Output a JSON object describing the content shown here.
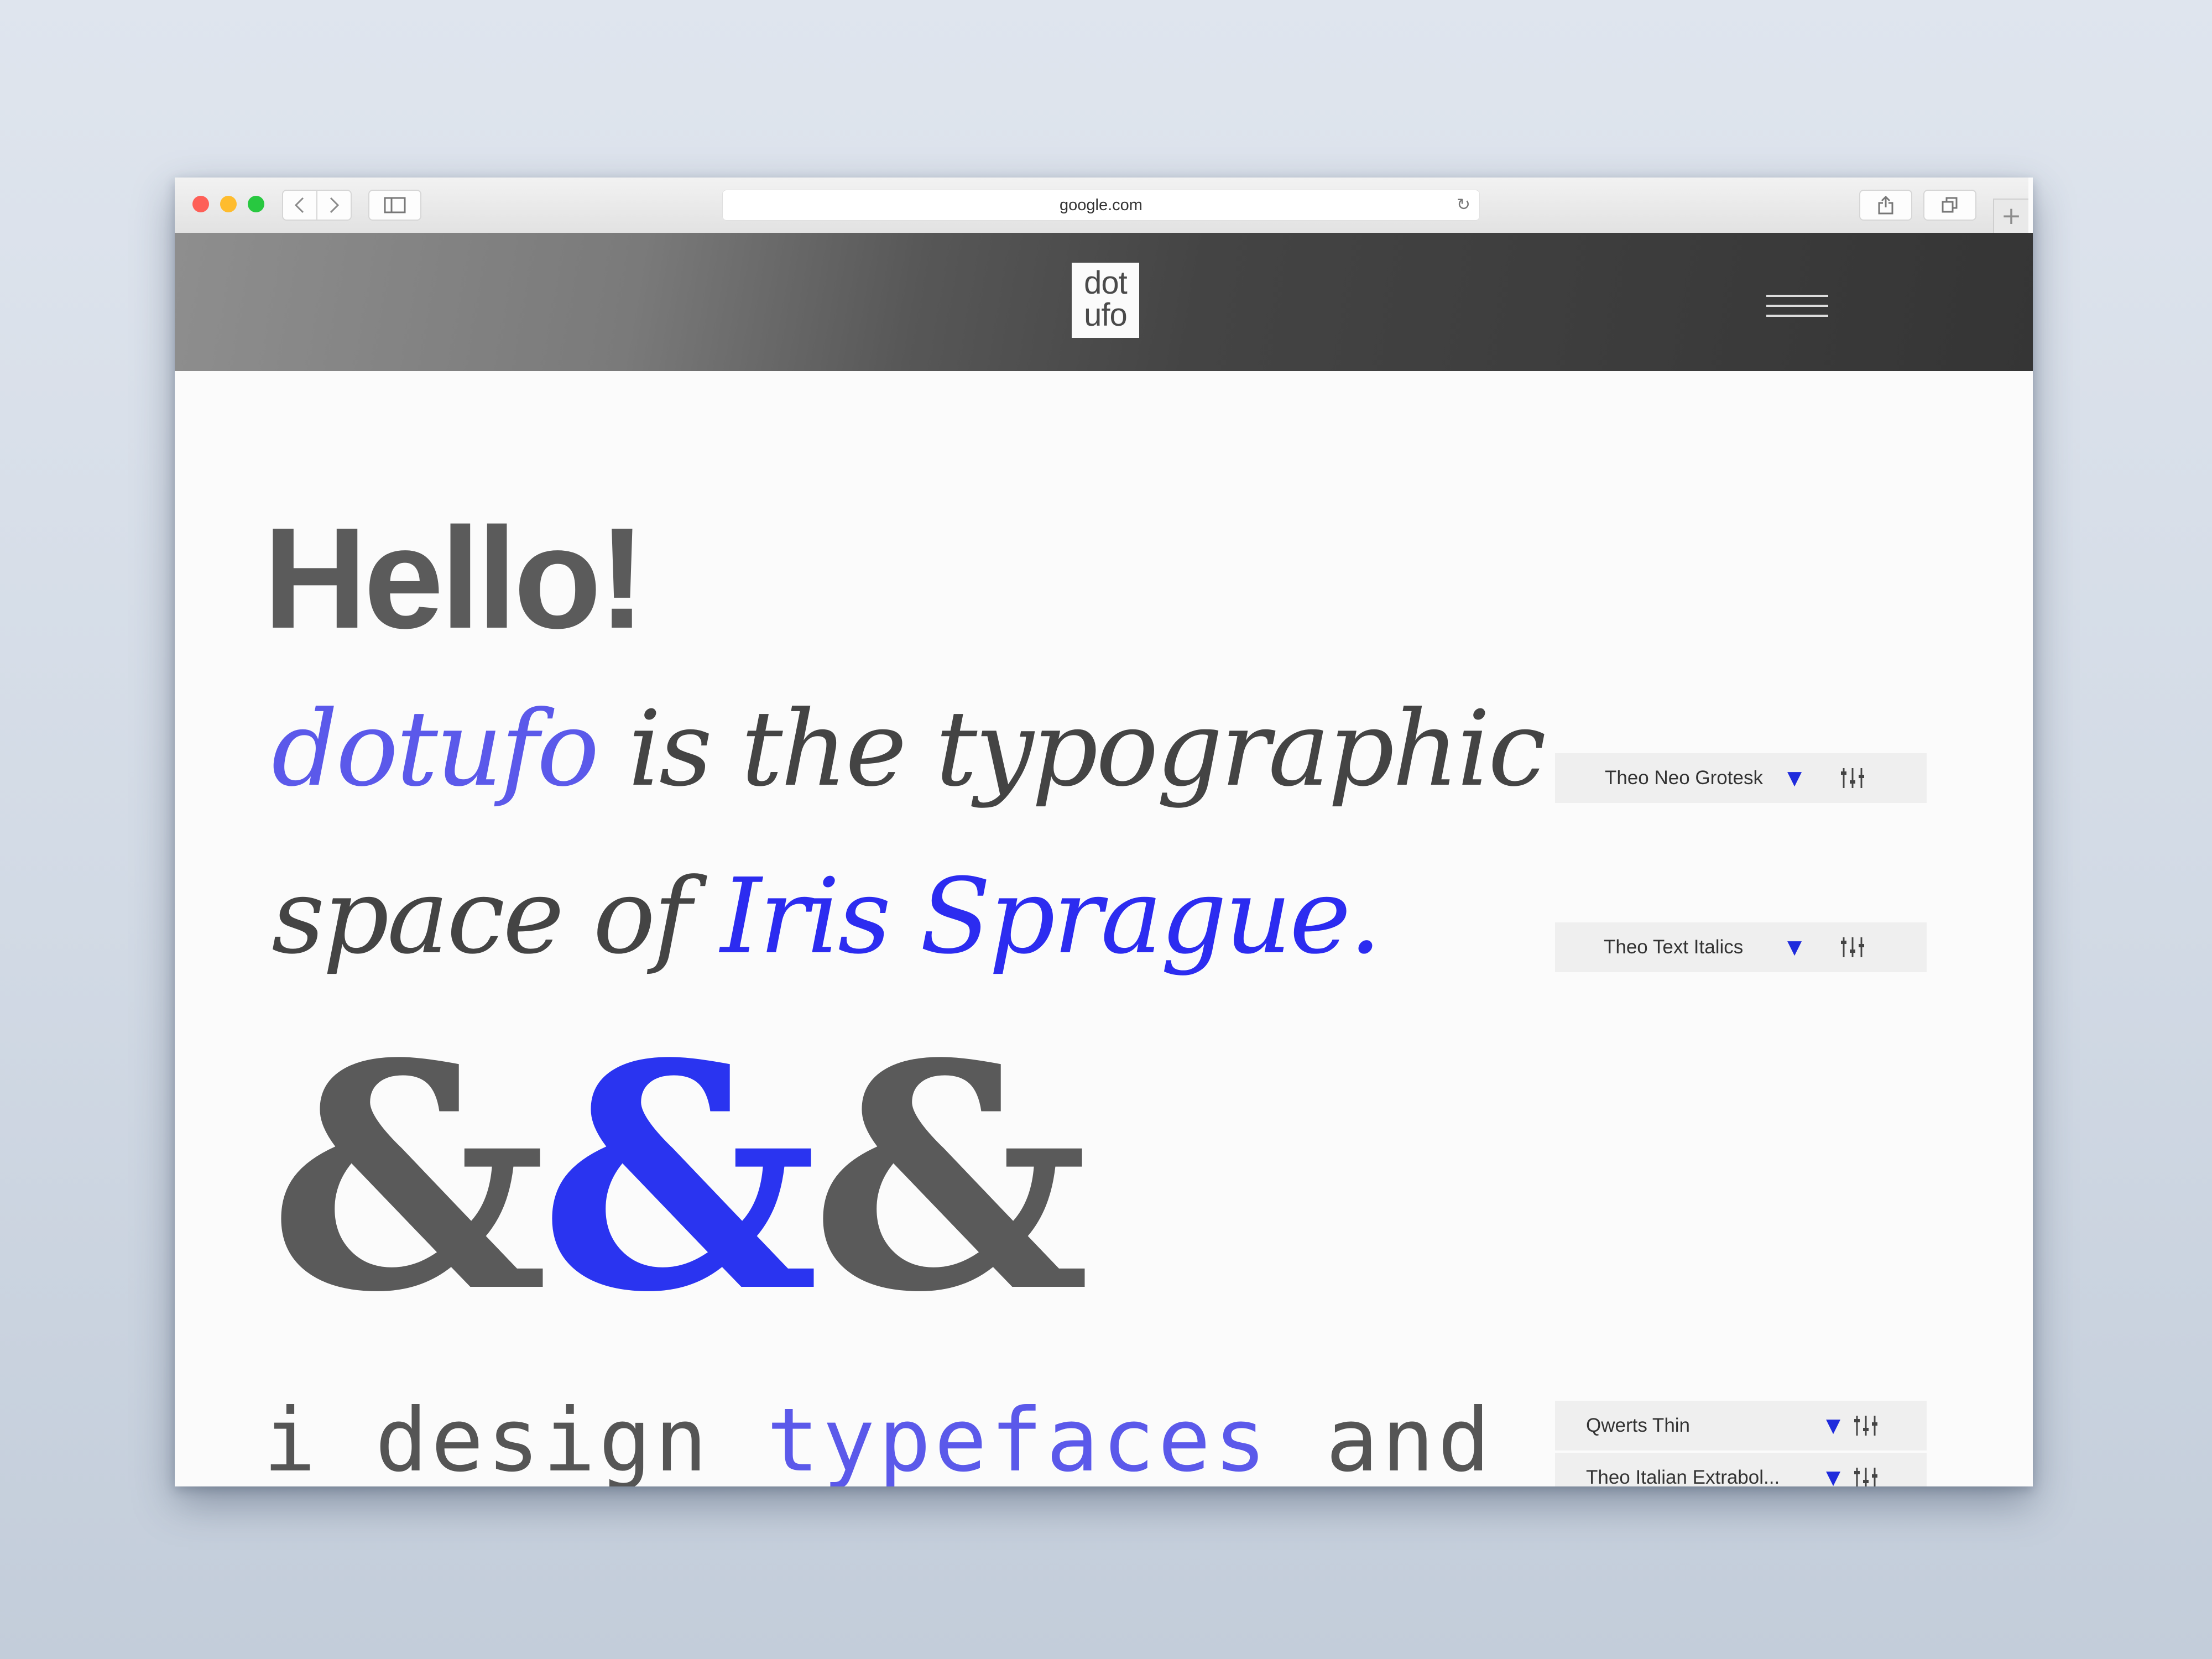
{
  "browser": {
    "url": "google.com",
    "nav_back_icon": "chevron-left-icon",
    "nav_forward_icon": "chevron-right-icon",
    "new_tab_symbol": "+"
  },
  "site": {
    "logo_line1": "dot",
    "logo_line2": "ufo"
  },
  "hero": {
    "hello": "Hello!",
    "line1_brand": "dotufo",
    "line1_rest": " is the typographic",
    "line2_start": "space of ",
    "line2_name": "Iris Sprague",
    "line2_end": ".",
    "ampersands": [
      "&",
      "&",
      "&"
    ],
    "mono_start": "i design ",
    "mono_highlight": "typefaces",
    "mono_end": " and"
  },
  "font_controls": [
    {
      "name": "Theo Neo Grotesk",
      "arrow": "▼"
    },
    {
      "name": "Theo Text Italics",
      "arrow": "▼"
    },
    {
      "name": "Theo Italian Extrabol...",
      "arrow": "▼"
    },
    {
      "name": "Qwerts Thin",
      "arrow": "▼"
    }
  ],
  "colors": {
    "accent_blue": "#2c2cf0",
    "soft_blue": "#5b59ea",
    "text_gray": "#444444"
  }
}
